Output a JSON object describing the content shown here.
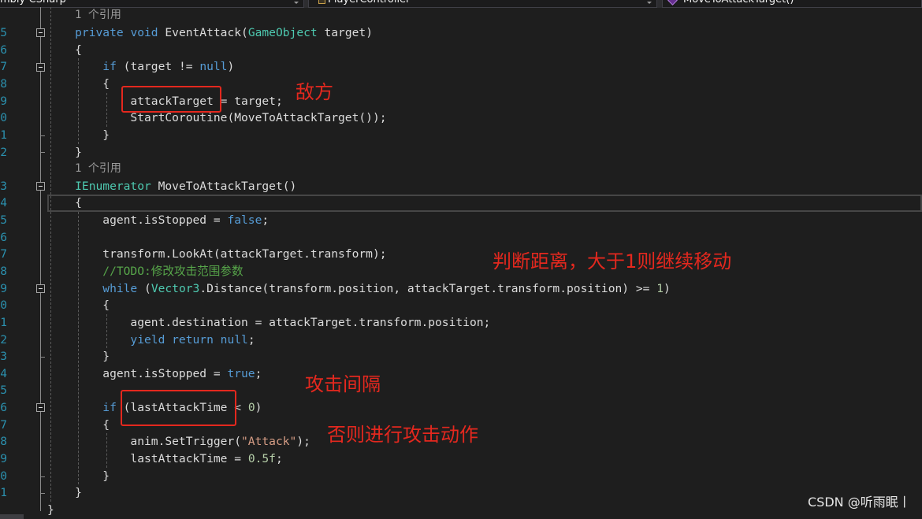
{
  "navigation_bar": {
    "project": "mbly-CSharp",
    "type": "PlayerController",
    "member": "MoveToAttackTarget()"
  },
  "icons": {
    "type": "class-icon",
    "member": "method-icon",
    "dropdown": "chevron-down-icon",
    "collapse": "collapse-icon"
  },
  "colors": {
    "background": "#1e1e1e",
    "line_number": "#2b91af",
    "codelens": "#999999",
    "annotation": "#e4281e",
    "watermark": "#e6e6e6"
  },
  "editor": {
    "lines": [
      {
        "codelens": "1 个引用"
      },
      {
        "no": "5",
        "tokens": [
          {
            "text": "    private",
            "color": "#569cd6"
          },
          {
            "text": " void",
            "color": "#569cd6"
          },
          {
            "text": " EventAttack(",
            "color": "#dcdcdc"
          },
          {
            "text": "GameObject",
            "color": "#4ec9b0"
          },
          {
            "text": " target)",
            "color": "#dcdcdc"
          }
        ]
      },
      {
        "no": "6",
        "tokens": [
          {
            "text": "    {",
            "color": "#dcdcdc"
          }
        ]
      },
      {
        "no": "7",
        "tokens": [
          {
            "text": "        if",
            "color": "#569cd6"
          },
          {
            "text": " (target != ",
            "color": "#dcdcdc"
          },
          {
            "text": "null",
            "color": "#569cd6"
          },
          {
            "text": ")",
            "color": "#dcdcdc"
          }
        ]
      },
      {
        "no": "8",
        "tokens": [
          {
            "text": "        {",
            "color": "#dcdcdc"
          }
        ]
      },
      {
        "no": "9",
        "tokens": [
          {
            "text": "            attackTarget = target;",
            "color": "#dcdcdc"
          }
        ]
      },
      {
        "no": "0",
        "tokens": [
          {
            "text": "            StartCoroutine(MoveToAttackTarget());",
            "color": "#dcdcdc"
          }
        ]
      },
      {
        "no": "1",
        "tokens": [
          {
            "text": "        }",
            "color": "#dcdcdc"
          }
        ]
      },
      {
        "no": "2",
        "tokens": [
          {
            "text": "    }",
            "color": "#dcdcdc"
          }
        ]
      },
      {
        "codelens": "1 个引用"
      },
      {
        "no": "3",
        "tokens": [
          {
            "text": "    IEnumerator",
            "color": "#4ec9b0"
          },
          {
            "text": " MoveToAttackTarget()",
            "color": "#dcdcdc"
          }
        ]
      },
      {
        "no": "4",
        "tokens": [
          {
            "text": "    {",
            "color": "#dcdcdc"
          }
        ]
      },
      {
        "no": "5",
        "tokens": [
          {
            "text": "        agent.isStopped = ",
            "color": "#dcdcdc"
          },
          {
            "text": "false",
            "color": "#569cd6"
          },
          {
            "text": ";",
            "color": "#dcdcdc"
          }
        ]
      },
      {
        "no": "6",
        "tokens": []
      },
      {
        "no": "7",
        "tokens": [
          {
            "text": "        transform.LookAt(attackTarget.transform);",
            "color": "#dcdcdc"
          }
        ]
      },
      {
        "no": "8",
        "tokens": [
          {
            "text": "        //TODO:修改攻击范围参数",
            "color": "#57a64a"
          }
        ]
      },
      {
        "no": "9",
        "tokens": [
          {
            "text": "        while",
            "color": "#569cd6"
          },
          {
            "text": " (",
            "color": "#dcdcdc"
          },
          {
            "text": "Vector3",
            "color": "#4ec9b0"
          },
          {
            "text": ".Distance(transform.position, attackTarget.transform.position) >= ",
            "color": "#dcdcdc"
          },
          {
            "text": "1",
            "color": "#b5cea8"
          },
          {
            "text": ")",
            "color": "#dcdcdc"
          }
        ]
      },
      {
        "no": "0",
        "tokens": [
          {
            "text": "        {",
            "color": "#dcdcdc"
          }
        ]
      },
      {
        "no": "1",
        "tokens": [
          {
            "text": "            agent.destination = attackTarget.transform.position;",
            "color": "#dcdcdc"
          }
        ]
      },
      {
        "no": "2",
        "tokens": [
          {
            "text": "            yield return null",
            "color": "#569cd6"
          },
          {
            "text": ";",
            "color": "#dcdcdc"
          }
        ]
      },
      {
        "no": "3",
        "tokens": [
          {
            "text": "        }",
            "color": "#dcdcdc"
          }
        ]
      },
      {
        "no": "4",
        "tokens": [
          {
            "text": "        agent.isStopped = ",
            "color": "#dcdcdc"
          },
          {
            "text": "true",
            "color": "#569cd6"
          },
          {
            "text": ";",
            "color": "#dcdcdc"
          }
        ]
      },
      {
        "no": "5",
        "tokens": []
      },
      {
        "no": "6",
        "tokens": [
          {
            "text": "        if",
            "color": "#569cd6"
          },
          {
            "text": " (lastAttackTime < ",
            "color": "#dcdcdc"
          },
          {
            "text": "0",
            "color": "#b5cea8"
          },
          {
            "text": ")",
            "color": "#dcdcdc"
          }
        ]
      },
      {
        "no": "7",
        "tokens": [
          {
            "text": "        {",
            "color": "#dcdcdc"
          }
        ]
      },
      {
        "no": "8",
        "tokens": [
          {
            "text": "            anim.SetTrigger(",
            "color": "#dcdcdc"
          },
          {
            "text": "\"Attack\"",
            "color": "#d69d85"
          },
          {
            "text": ");",
            "color": "#dcdcdc"
          }
        ]
      },
      {
        "no": "9",
        "tokens": [
          {
            "text": "            lastAttackTime = ",
            "color": "#dcdcdc"
          },
          {
            "text": "0.5f",
            "color": "#b5cea8"
          },
          {
            "text": ";",
            "color": "#dcdcdc"
          }
        ]
      },
      {
        "no": "0",
        "tokens": [
          {
            "text": "        }",
            "color": "#dcdcdc"
          }
        ]
      },
      {
        "no": "1",
        "tokens": [
          {
            "text": "    }",
            "color": "#dcdcdc"
          }
        ]
      },
      {
        "tokens": [
          {
            "text": "}",
            "color": "#dcdcdc"
          }
        ]
      }
    ]
  },
  "annotations": {
    "enemy": "敌方",
    "distance_check": "判断距离，大于1则继续移动",
    "attack_interval": "攻击间隔",
    "otherwise_attack": "否则进行攻击动作"
  },
  "watermark": "CSDN @听雨眠丨"
}
